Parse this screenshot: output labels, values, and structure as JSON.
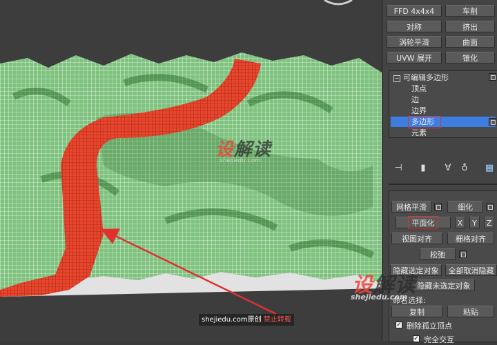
{
  "modifier_buttons": {
    "ffd": "FFD 4x4x4",
    "lathe": "车削",
    "mirror": "对称",
    "extrude": "挤出",
    "turbosmooth": "涡轮平滑",
    "surface": "曲面",
    "uvw": "UVW 展开",
    "taper": "锥化"
  },
  "stack": {
    "root": "可编辑多边形",
    "items": [
      "顶点",
      "边",
      "边界",
      "多边形",
      "元素"
    ],
    "selected": "多边形"
  },
  "edit_geometry": {
    "meshsmooth": "网格平滑",
    "tessellate": "细化",
    "make_planar": "平面化",
    "x": "X",
    "y": "Y",
    "z": "Z",
    "view_align": "视图对齐",
    "grid_align": "栅格对齐",
    "relax": "松弛",
    "hide_selected": "隐藏选定对象",
    "unhide_all": "全部取消隐藏",
    "hide_unselected": "隐藏未选定对象",
    "named_selections": "命名选择:",
    "copy": "复制",
    "paste": "粘贴",
    "delete_isolated": "删除孤立顶点",
    "full_interactivity": "完全交互"
  },
  "watermarks": {
    "brand_cn_1": "设",
    "brand_cn_2": "解读",
    "brand_en": "shejiedu.com",
    "credit_site": "shejiedu.com",
    "credit_original": "原创",
    "credit_nocopy": "禁止转载"
  },
  "colors": {
    "terrain": "#7fc27f",
    "path": "#e8452c",
    "selection": "#3d7ee0",
    "annotation": "#e03030"
  }
}
